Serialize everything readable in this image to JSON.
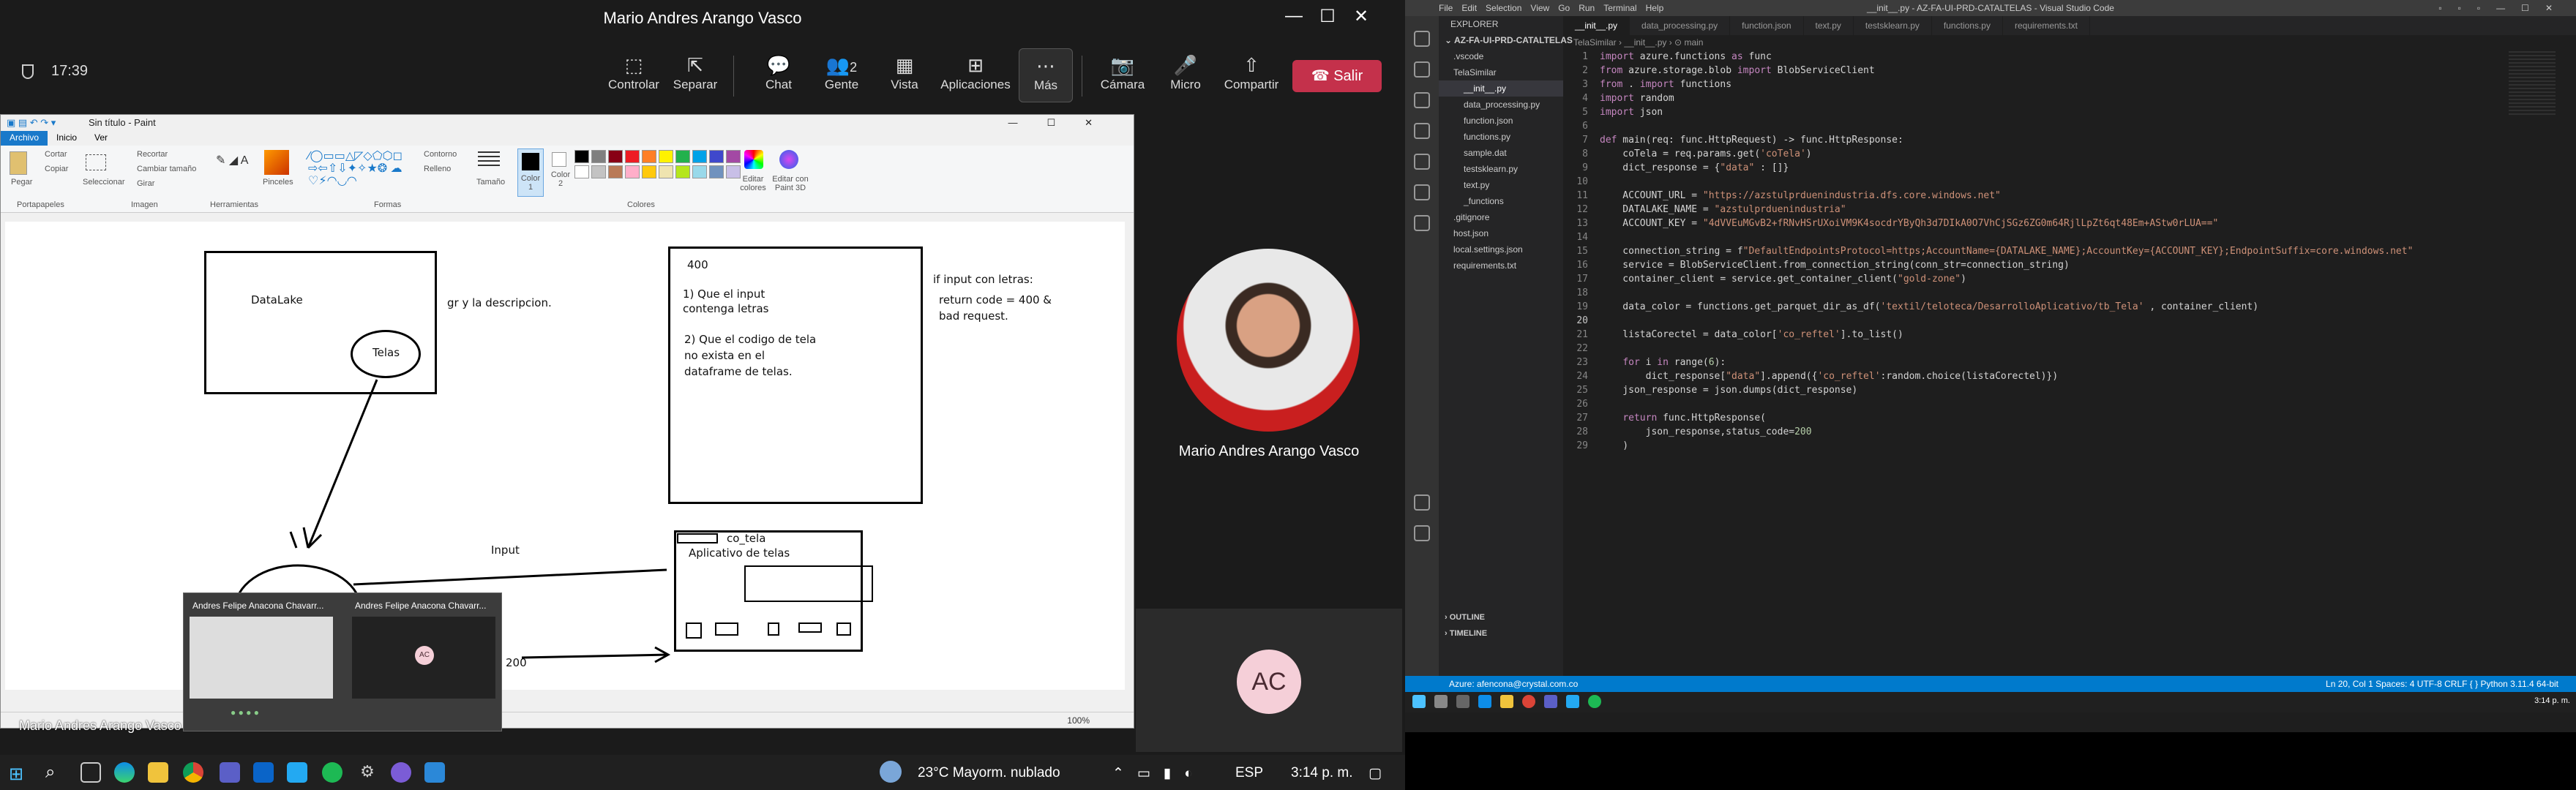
{
  "teams": {
    "window_title": "Mario Andres Arango Vasco",
    "window_controls": {
      "minimize": "—",
      "maximize": "☐",
      "close": "✕"
    },
    "elapsed": "17:39",
    "toolbar": [
      {
        "label": "Controlar",
        "icon": "control-icon",
        "glyph": "⬚"
      },
      {
        "label": "Separar",
        "icon": "popout-icon",
        "glyph": "⇱"
      },
      {
        "label": "Chat",
        "icon": "chat-icon",
        "glyph": "💬"
      },
      {
        "label": "Gente",
        "icon": "people-icon",
        "glyph": "👥",
        "count": "2"
      },
      {
        "label": "Vista",
        "icon": "view-icon",
        "glyph": "▦"
      },
      {
        "label": "Aplicaciones",
        "icon": "apps-icon",
        "glyph": "⊞"
      },
      {
        "label": "Más",
        "icon": "more-icon",
        "glyph": "⋯"
      },
      {
        "label": "Cámara",
        "icon": "camera-off-icon",
        "glyph": "📷"
      },
      {
        "label": "Micro",
        "icon": "mic-icon",
        "glyph": "🎤"
      },
      {
        "label": "Compartir",
        "icon": "share-icon",
        "glyph": "⇧"
      }
    ],
    "leave_label": "Salir",
    "presenter_name": "Mario Andres Arango Vasco",
    "participant_initials": "AC",
    "shared_name_overlay": "Mario Andres Arango Vasco"
  },
  "paint": {
    "title": "Sin título - Paint",
    "tabs": [
      "Archivo",
      "Inicio",
      "Ver"
    ],
    "groups": [
      "Portapapeles",
      "Imagen",
      "Herramientas",
      "Formas",
      "Colores"
    ],
    "tool_labels": {
      "paste": "Pegar",
      "cut": "Cortar",
      "copy": "Copiar",
      "select": "Seleccionar",
      "crop": "Recortar",
      "resize": "Cambiar tamaño",
      "rotate": "Girar",
      "brushes": "Pinceles",
      "outline": "Contorno",
      "fill": "Relleno",
      "size": "Tamaño",
      "color1": "Color 1",
      "color2": "Color 2",
      "edit_colors": "Editar colores",
      "paint3d": "Editar con Paint 3D"
    },
    "palette": [
      "#000000",
      "#7f7f7f",
      "#880015",
      "#ed1c24",
      "#ff7f27",
      "#fff200",
      "#22b14c",
      "#00a2e8",
      "#3f48cc",
      "#a349a4",
      "#ffffff",
      "#c3c3c3",
      "#b97a57",
      "#ffaec9",
      "#ffc90e",
      "#efe4b0",
      "#b5e61d",
      "#99d9ea",
      "#7092be",
      "#c8bfe7"
    ],
    "canvas_text": {
      "datalake": "DataLake",
      "telas": "Telas",
      "desc": "gr y la descripcion.",
      "num": "400",
      "q1a": "1) Que el input",
      "q1b": "contenga letras",
      "q2a": "2) Que el codigo de tela",
      "q2b": "no exista en el",
      "q2c": "dataframe de telas.",
      "if": "if input con letras:",
      "ret1": "return code = 400 &",
      "ret2": "bad request.",
      "input": "Input",
      "code200": "200",
      "co_tela": "co_tela",
      "app": "Aplicativo de telas"
    },
    "zoom": "100%"
  },
  "thumbnails": [
    {
      "title": "Andres Felipe Anacona Chavarr..."
    },
    {
      "title": "Andres Felipe Anacona Chavarr...",
      "initials": "AC"
    }
  ],
  "taskbar": {
    "weather": "23°C  Mayorm. nublado",
    "lang": "ESP",
    "time": "3:14 p. m."
  },
  "vscode": {
    "title": "__init__.py - AZ-FA-UI-PRD-CATALTELAS - Visual Studio Code",
    "menu": [
      "File",
      "Edit",
      "Selection",
      "View",
      "Go",
      "Run",
      "Terminal",
      "Help"
    ],
    "explorer_header": "EXPLORER",
    "project": "AZ-FA-UI-PRD-CATALTELAS",
    "tree": [
      ".vscode",
      "TelaSimilar",
      "__init__.py",
      "data_processing.py",
      "function.json",
      "functions.py",
      "sample.dat",
      "testsklearn.py",
      "text.py",
      "_functions",
      ".gitignore",
      "host.json",
      "local.settings.json",
      "requirements.txt"
    ],
    "outline": "OUTLINE",
    "timeline": "TIMELINE",
    "tabs": [
      "__init__.py",
      "data_processing.py",
      "function.json",
      "text.py",
      "testsklearn.py",
      "functions.py",
      "requirements.txt"
    ],
    "breadcrumb": "TelaSimilar  ›  __init__.py  ›  ⊙ main",
    "code_lines": [
      "import azure.functions as func",
      "from azure.storage.blob import BlobServiceClient",
      "from . import functions",
      "import random",
      "import json",
      "",
      "def main(req: func.HttpRequest) -> func.HttpResponse:",
      "    coTela = req.params.get('coTela')",
      "    dict_response = {\"data\" : []}",
      "",
      "    ACCOUNT_URL = \"https://azstulprduenindustria.dfs.core.windows.net\"",
      "    DATALAKE_NAME = \"azstulprduenindustria\"",
      "    ACCOUNT_KEY = \"4dVVEuMGvB2+fRNvHSrUXoiVM9K4socdrYByQh3d7DIkA0O7VhCjSGz6ZG0m64RjlLpZt6qt48Em+AStw0rLUA==\"",
      "",
      "    connection_string = f\"DefaultEndpointsProtocol=https;AccountName={DATALAKE_NAME};AccountKey={ACCOUNT_KEY};EndpointSuffix=core.windows.net\"",
      "    service = BlobServiceClient.from_connection_string(conn_str=connection_string)",
      "    container_client = service.get_container_client(\"gold-zone\")",
      "",
      "    data_color = functions.get_parquet_dir_as_df('textil/teloteca/DesarrolloAplicativo/tb_Tela' , container_client)",
      "",
      "    listaCorectel = data_color['co_reftel'].to_list()",
      "",
      "    for i in range(6):",
      "        dict_response[\"data\"].append({'co_reftel':random.choice(listaCorectel)})",
      "    json_response = json.dumps(dict_response)",
      "",
      "    return func.HttpResponse(",
      "        json_response,status_code=200",
      "    )"
    ],
    "status_left": "Azure: afencona@crystal.com.co",
    "status_right": "Ln 20, Col 1    Spaces: 4    UTF-8    CRLF    { } Python    3.11.4 64-bit",
    "clock": "3:14 p. m."
  }
}
